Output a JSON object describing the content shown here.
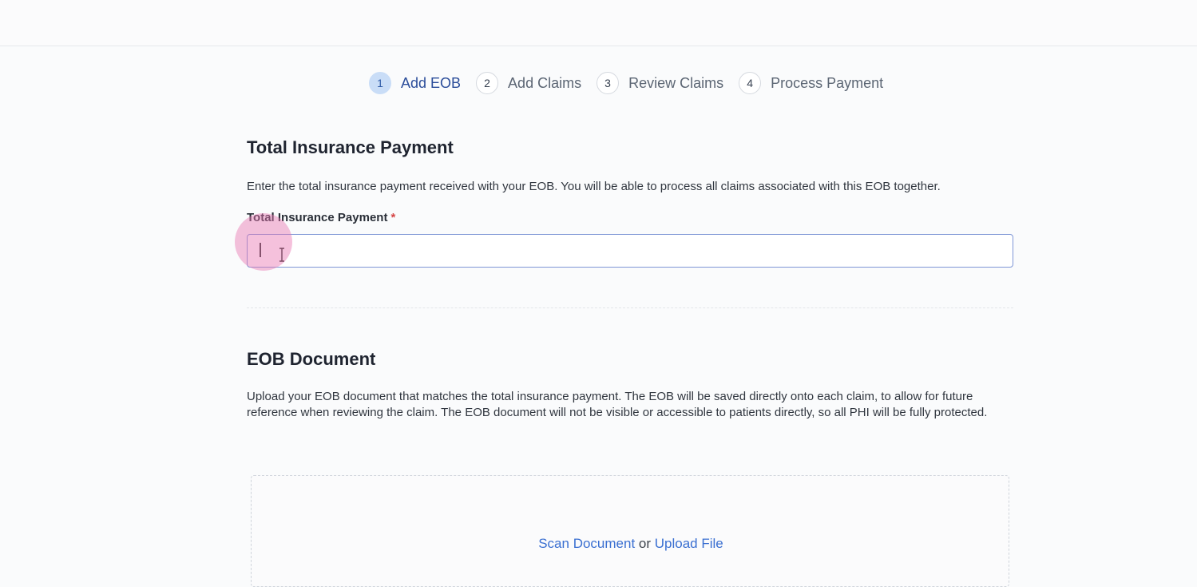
{
  "stepper": {
    "steps": [
      {
        "number": "1",
        "label": "Add EOB",
        "active": true
      },
      {
        "number": "2",
        "label": "Add Claims",
        "active": false
      },
      {
        "number": "3",
        "label": "Review Claims",
        "active": false
      },
      {
        "number": "4",
        "label": "Process Payment",
        "active": false
      }
    ]
  },
  "payment_section": {
    "title": "Total Insurance Payment",
    "description": "Enter the total insurance payment received with your EOB. You will be able to process all claims associated with this EOB together.",
    "field_label": "Total Insurance Payment",
    "required_marker": "*",
    "input_value": ""
  },
  "eob_section": {
    "title": "EOB Document",
    "description": "Upload your EOB document that matches the total insurance payment. The EOB will be saved directly onto each claim, to allow for future reference when reviewing the claim. The EOB document will not be visible or accessible to patients directly, so all PHI will be fully protected.",
    "scan_label": "Scan Document",
    "or_text": "or",
    "upload_label": "Upload File"
  },
  "colors": {
    "accent": "#3a6fd1",
    "active_step_bg": "#c9ddf7",
    "required": "#d64545",
    "click_highlight": "#e876b2"
  }
}
